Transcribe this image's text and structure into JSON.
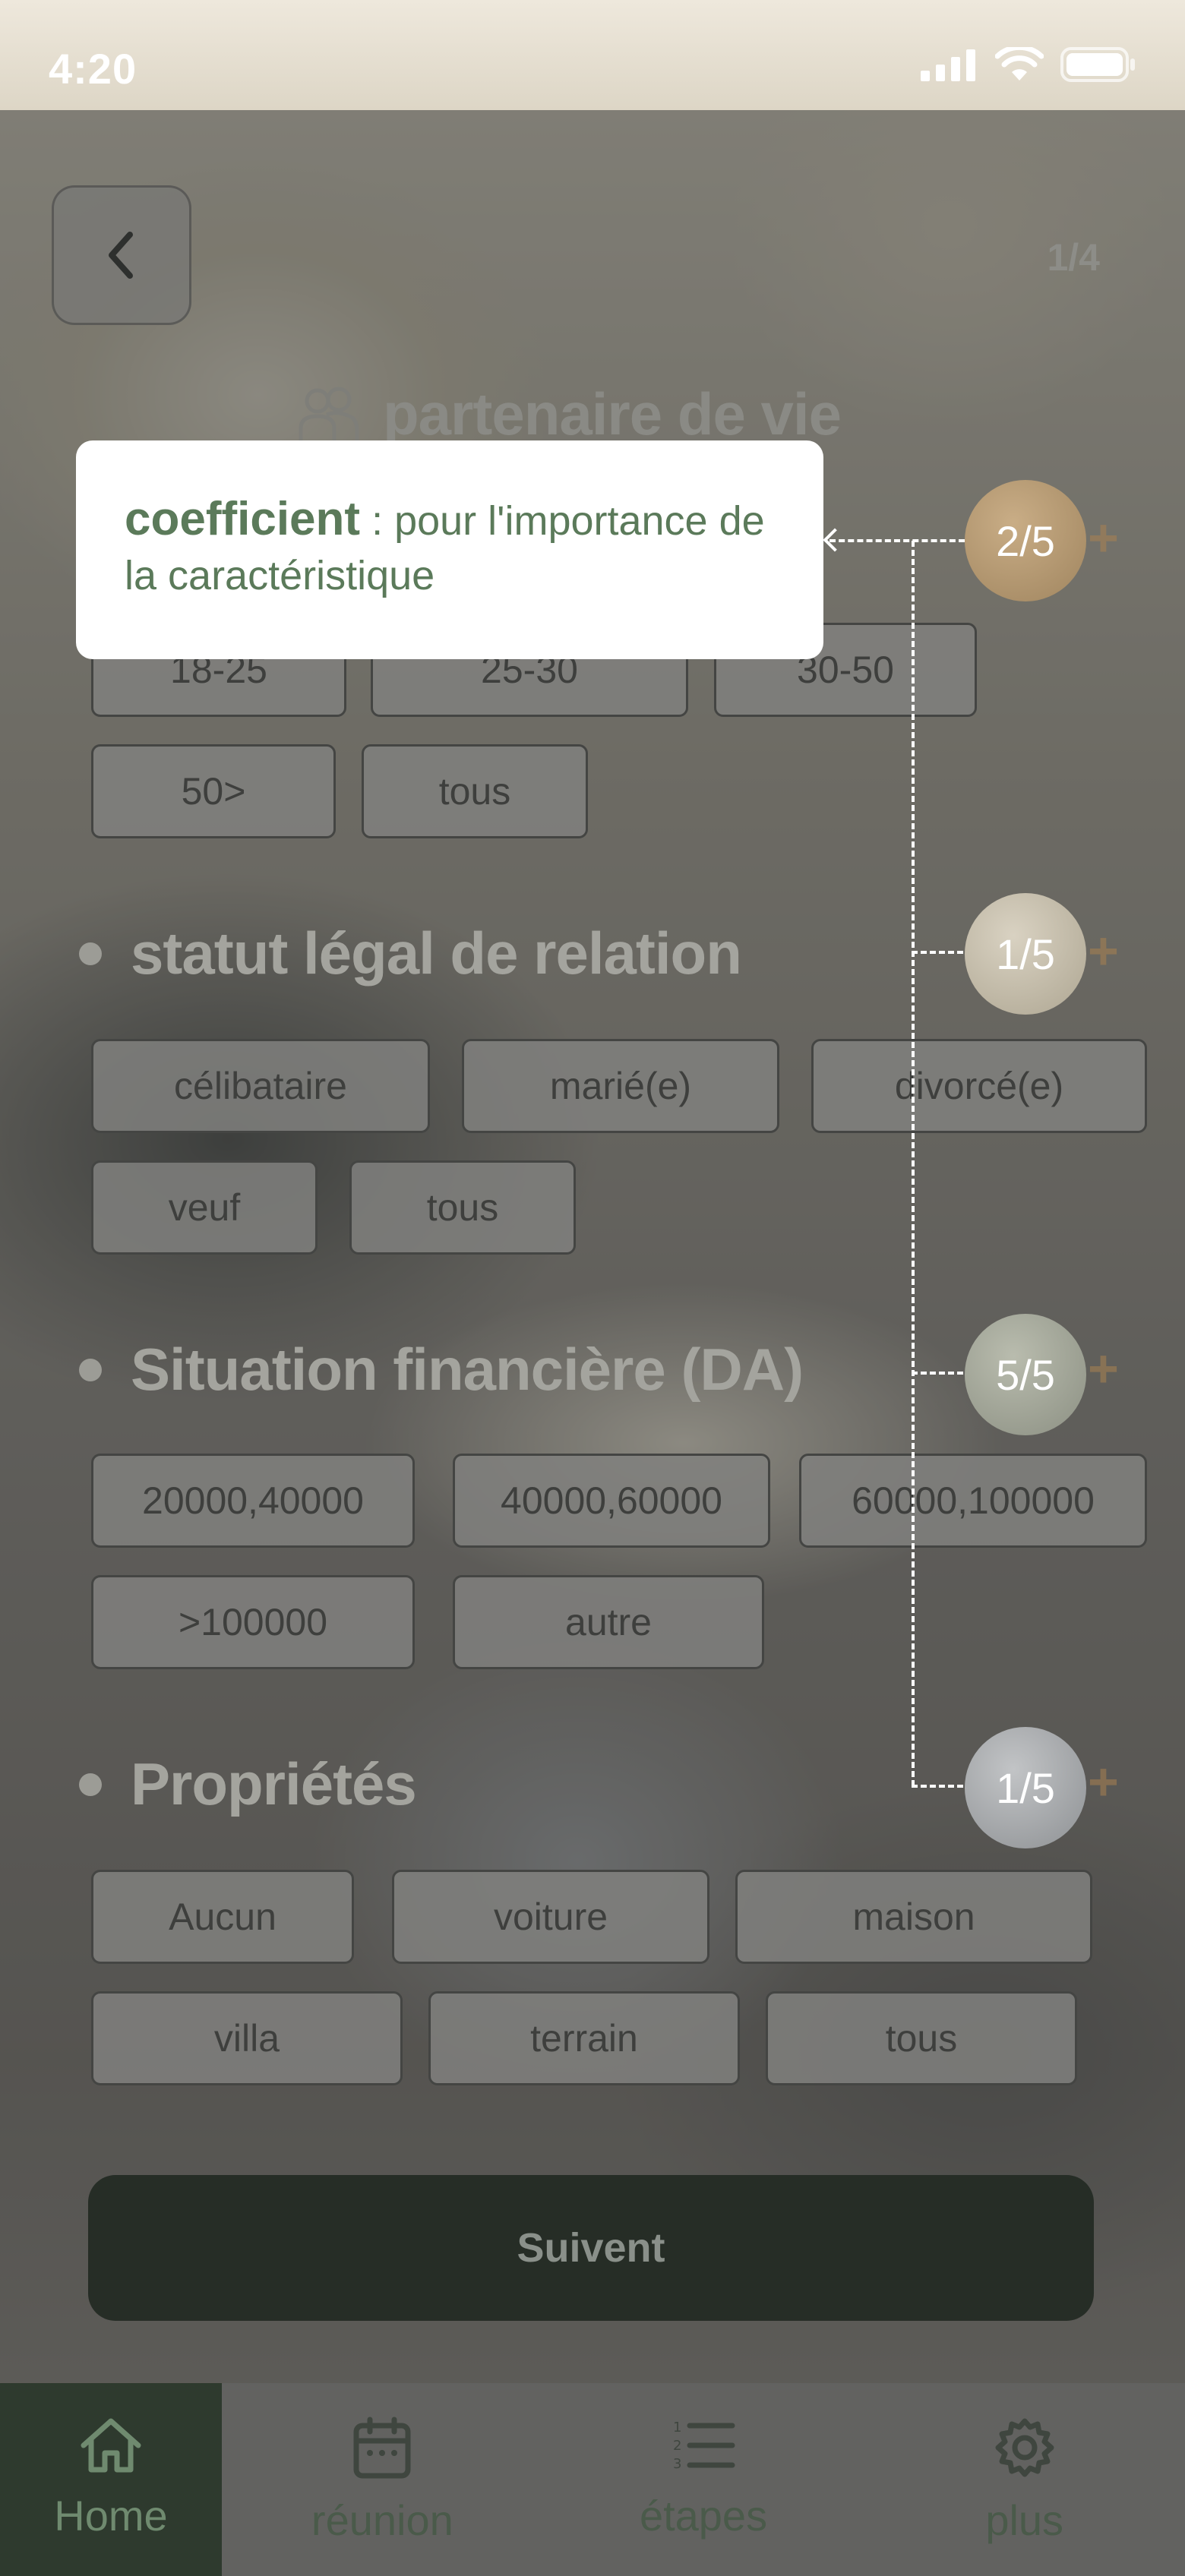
{
  "status_bar": {
    "time": "4:20"
  },
  "header": {
    "back_icon": "chevron-left-icon",
    "page_counter": "1/4",
    "section_icon": "couple-icon",
    "section_title": "partenaire de vie"
  },
  "tooltip": {
    "term": "coefficient",
    "text": " : pour l'importance de la caractéristique"
  },
  "criteria": [
    {
      "title": "",
      "coefficient": "2/5",
      "options": [
        "18-25",
        "25-30",
        "30-50",
        "50>",
        "tous"
      ]
    },
    {
      "title": "statut légal de relation",
      "coefficient": "1/5",
      "options": [
        "célibataire",
        "marié(e)",
        "divorcé(e)",
        "veuf",
        "tous"
      ]
    },
    {
      "title": "Situation financière (DA)",
      "coefficient": "5/5",
      "options": [
        "20000,40000",
        "40000,60000",
        "60000,100000",
        ">100000",
        "autre"
      ]
    },
    {
      "title": "Propriétés",
      "coefficient": "1/5",
      "options": [
        "Aucun",
        "voiture",
        "maison",
        "villa",
        "terrain",
        "tous"
      ]
    }
  ],
  "plus_symbol": "+",
  "submit_label": "Suivent",
  "nav": [
    {
      "label": "Home",
      "icon": "home-icon",
      "active": true
    },
    {
      "label": "réunion",
      "icon": "calendar-icon",
      "active": false
    },
    {
      "label": "étapes",
      "icon": "numbered-list-icon",
      "active": false
    },
    {
      "label": "plus",
      "icon": "gear-icon",
      "active": false
    }
  ],
  "colors": {
    "accent_dark": "#262d26",
    "tooltip_text": "#5b7a5a",
    "coef_tan": "#b59a78",
    "coef_light": "#c8c1b2",
    "coef_sage": "#a2a699",
    "coef_grey": "#a6a8aa"
  }
}
